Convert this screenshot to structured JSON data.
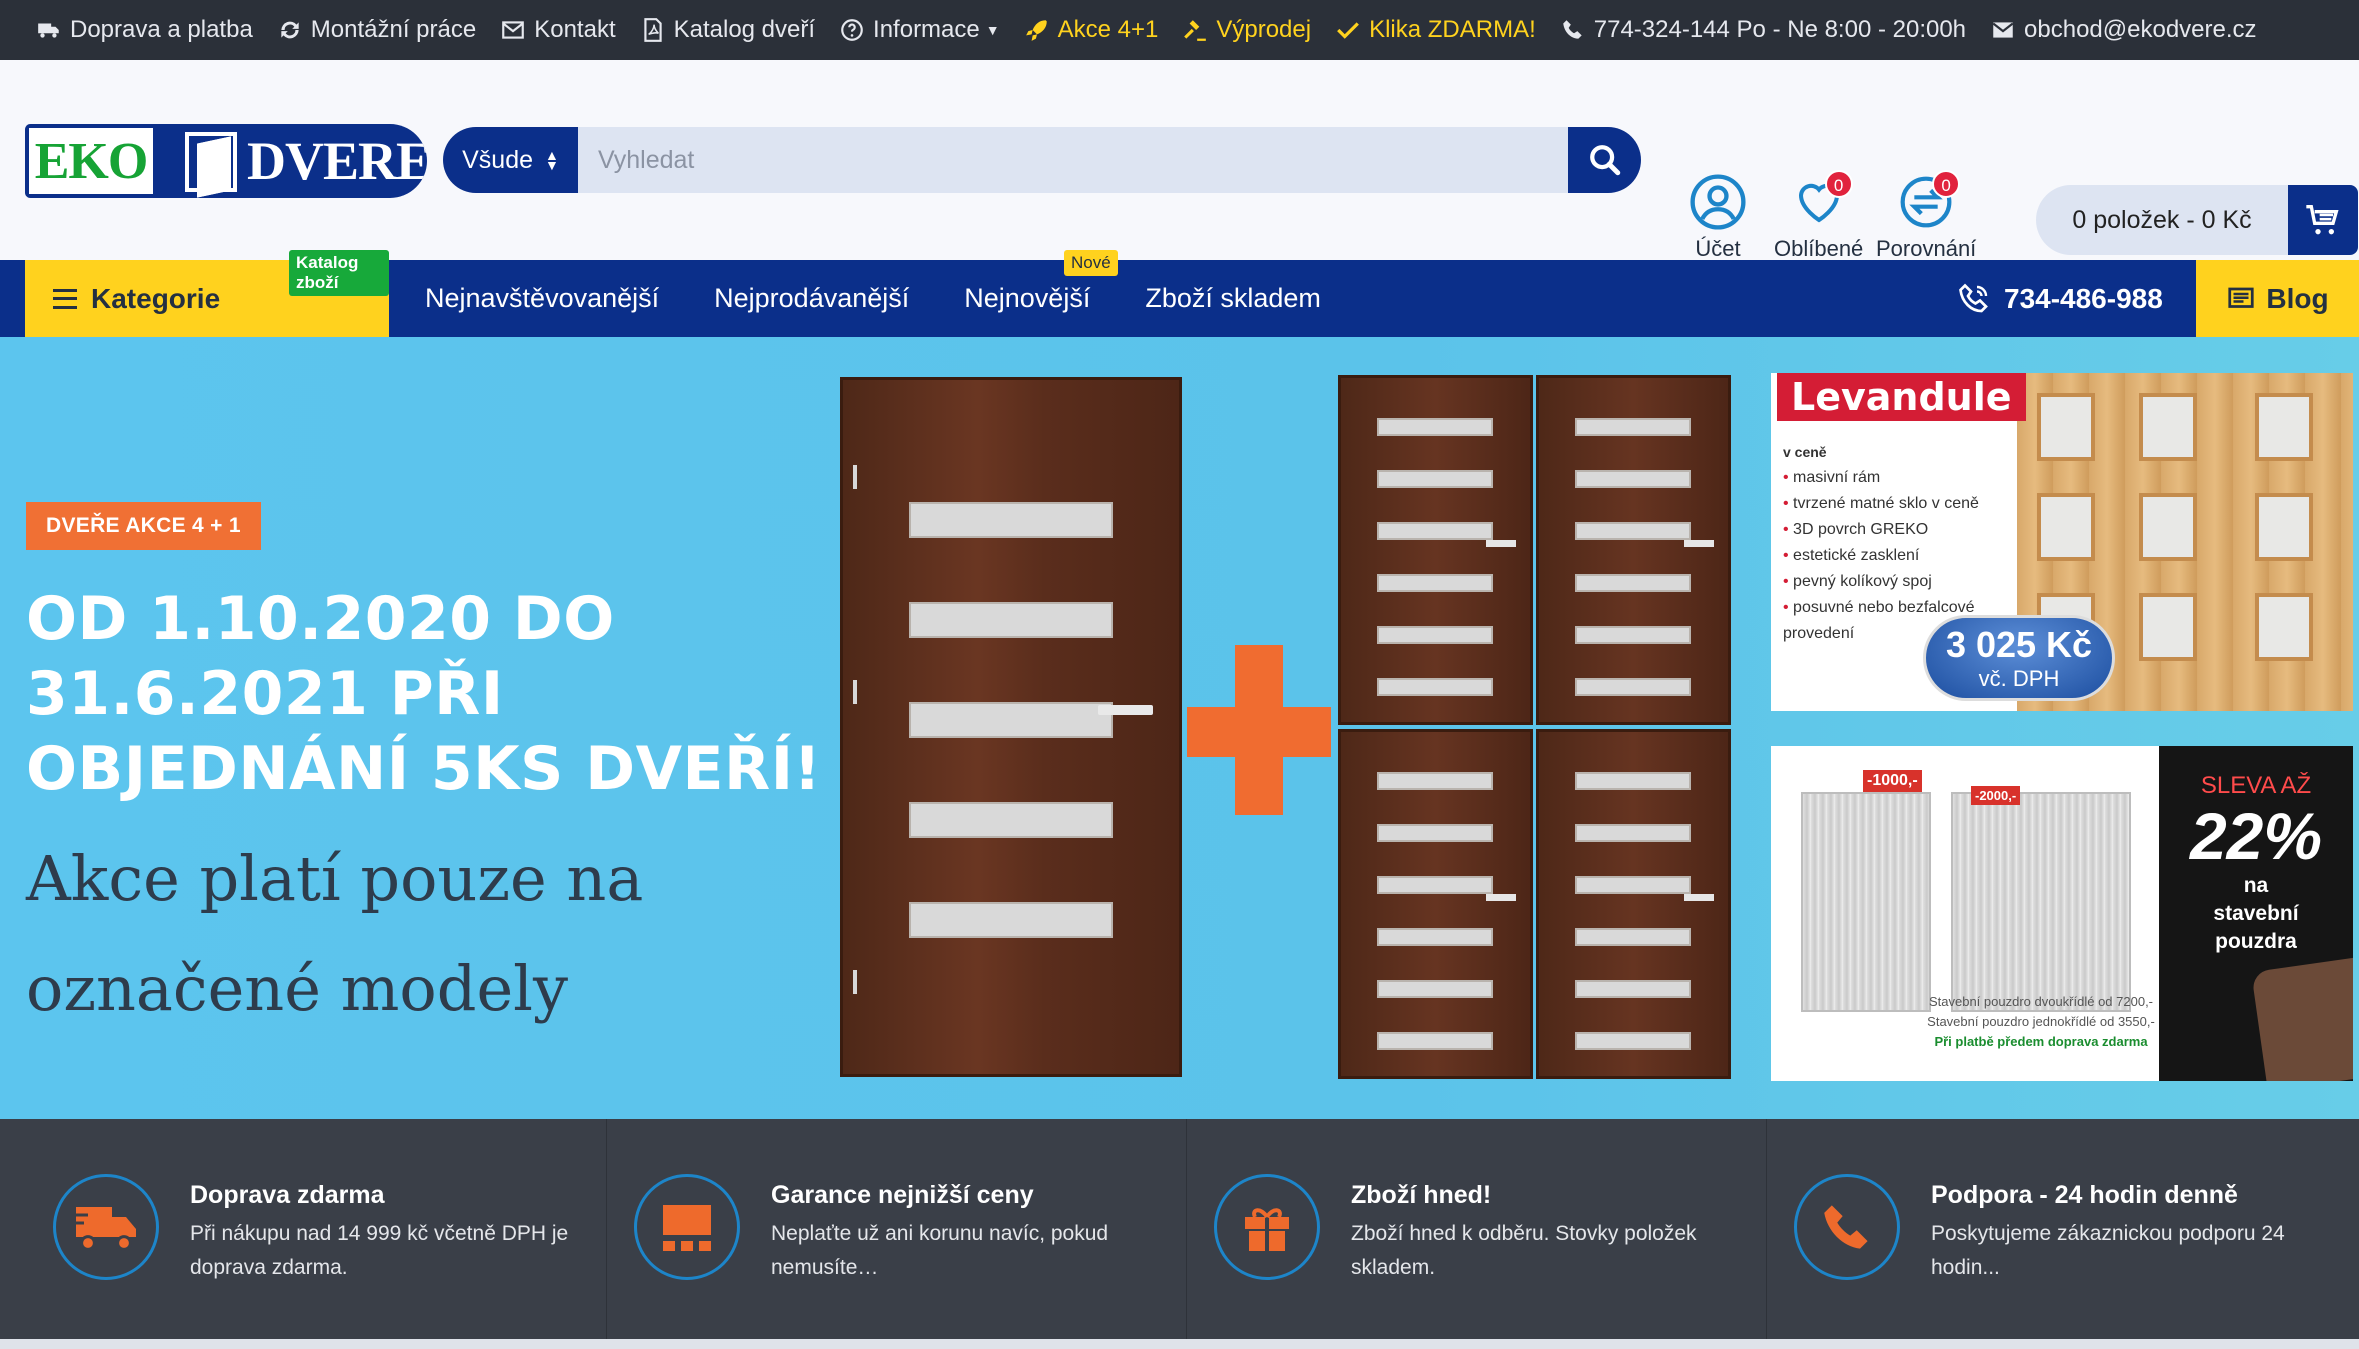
{
  "topbar": {
    "items": [
      {
        "label": "Doprava a platba"
      },
      {
        "label": "Montážní práce"
      },
      {
        "label": "Kontakt"
      },
      {
        "label": "Katalog dveří"
      },
      {
        "label": "Informace"
      },
      {
        "label": "Akce 4+1"
      },
      {
        "label": "Výprodej"
      },
      {
        "label": "Klika ZDARMA!"
      },
      {
        "label": "774-324-144 Po - Ne 8:00 - 20:00h"
      },
      {
        "label": "obchod@ekodvere.cz"
      }
    ],
    "highlight_color": "#ffd21e"
  },
  "logo": {
    "part1": "EKO",
    "part2": "DVERE"
  },
  "search": {
    "scope": "Všude",
    "placeholder": "Vyhledat"
  },
  "header_icons": {
    "account": {
      "label": "Účet"
    },
    "favorites": {
      "label": "Oblíbené",
      "count": "0"
    },
    "compare": {
      "label": "Porovnání",
      "count": "0"
    }
  },
  "cart": {
    "label": "0 položek - 0 Kč"
  },
  "nav": {
    "categories": "Kategorie",
    "catalog_tag": "Katalog zboží",
    "links": [
      "Nejnavštěvovanější",
      "Nejprodávanější",
      "Nejnovější",
      "Zboží skladem"
    ],
    "new_tag": "Nové",
    "phone": "734-486-988",
    "blog": "Blog",
    "accent": "#0b2f8a"
  },
  "hero": {
    "pill": "DVEŘE AKCE 4 + 1",
    "headline": "OD 1.10.2020 DO 31.6.2021 PŘI OBJEDNÁNÍ 5KS DVEŘÍ!",
    "subline": "Akce platí pouze na označené modely"
  },
  "promo_levandule": {
    "title": "Levandule",
    "list_heading": "v ceně",
    "items": [
      "masivní rám",
      "tvrzené matné sklo v ceně",
      "3D povrch GREKO",
      "estetické zasklení",
      "pevný kolíkový spoj",
      "posuvné nebo bezfalcové provedení"
    ],
    "price": "3 025 Kč",
    "price_note": "vč. DPH"
  },
  "promo_pouzdra": {
    "tag1": "-1000,-",
    "tag2": "-2000,-",
    "line1": "SLEVA AŽ",
    "percent": "22%",
    "line2": "na",
    "line3": "stavební",
    "line4": "pouzdra",
    "fine1": "Stavební pouzdro dvoukřídlé od 7200,-",
    "fine2": "Stavební pouzdro jednokřídlé od 3550,-",
    "fine3": "Při platbě předem doprava zdarma"
  },
  "features": [
    {
      "title": "Doprava zdarma",
      "text": "Při nákupu nad 14 999 kč včetně DPH je doprava zdarma.",
      "icon": "truck-icon"
    },
    {
      "title": "Garance nejnižší ceny",
      "text": "Neplaťte už ani korunu navíc, pokud nemusíte…",
      "icon": "warehouse-icon"
    },
    {
      "title": "Zboží hned!",
      "text": "Zboží hned k odběru. Stovky položek skladem.",
      "icon": "gift-icon"
    },
    {
      "title": "Podpora - 24 hodin denně",
      "text": "Poskytujeme zákaznickou podporu 24 hodin...",
      "icon": "phone-icon"
    }
  ]
}
